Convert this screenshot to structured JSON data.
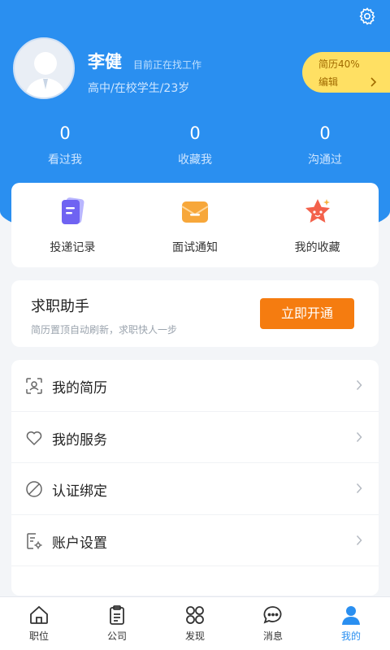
{
  "profile": {
    "name": "李健",
    "status": "目前正在找工作",
    "subtitle": "高中/在校学生/23岁"
  },
  "resume": {
    "progress": "简历40%",
    "edit_label": "编辑"
  },
  "stats": [
    {
      "num": "0",
      "label": "看过我"
    },
    {
      "num": "0",
      "label": "收藏我"
    },
    {
      "num": "0",
      "label": "沟通过"
    }
  ],
  "shortcuts": [
    {
      "label": "投递记录",
      "icon": "document-icon"
    },
    {
      "label": "面试通知",
      "icon": "envelope-icon"
    },
    {
      "label": "我的收藏",
      "icon": "star-icon"
    }
  ],
  "assistant": {
    "title": "求职助手",
    "desc": "简历置顶自动刷新，求职快人一步",
    "button": "立即开通"
  },
  "menu": [
    {
      "label": "我的简历",
      "icon": "resume-scan-icon"
    },
    {
      "label": "我的服务",
      "icon": "heart-icon"
    },
    {
      "label": "认证绑定",
      "icon": "leaf-icon"
    },
    {
      "label": "账户设置",
      "icon": "account-settings-icon"
    }
  ],
  "tabs": [
    {
      "label": "职位",
      "icon": "home-icon"
    },
    {
      "label": "公司",
      "icon": "clipboard-icon"
    },
    {
      "label": "发现",
      "icon": "grid-circles-icon"
    },
    {
      "label": "消息",
      "icon": "chat-icon"
    },
    {
      "label": "我的",
      "icon": "person-icon",
      "active": true
    }
  ],
  "colors": {
    "primary": "#2a8ff0",
    "accent_orange": "#f57c10",
    "pill_yellow": "#ffe063"
  }
}
